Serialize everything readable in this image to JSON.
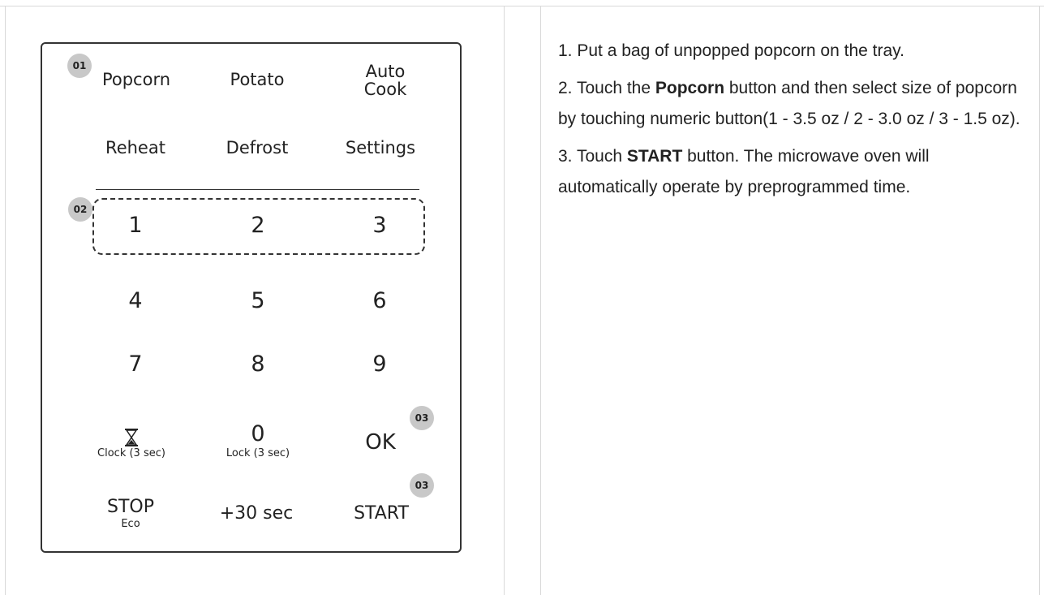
{
  "panel": {
    "buttons": {
      "popcorn": "Popcorn",
      "potato": "Potato",
      "auto_cook_line1": "Auto",
      "auto_cook_line2": "Cook",
      "reheat": "Reheat",
      "defrost": "Defrost",
      "settings": "Settings",
      "n1": "1",
      "n2": "2",
      "n3": "3",
      "n4": "4",
      "n5": "5",
      "n6": "6",
      "n7": "7",
      "n8": "8",
      "n9": "9",
      "clock_sub": "Clock (3 sec)",
      "n0": "0",
      "lock_sub": "Lock (3 sec)",
      "ok": "OK",
      "stop": "STOP",
      "eco_sub": "Eco",
      "plus30": "+30 sec",
      "start": "START"
    },
    "badges": {
      "b01": "01",
      "b02": "02",
      "b03_ok": "03",
      "b03_start": "03"
    }
  },
  "instructions": {
    "step1": "1. Put a bag of unpopped popcorn on the tray.",
    "step2_pre": "2. Touch the ",
    "step2_bold": "Popcorn",
    "step2_post": " button and then select size of popcorn by touching numeric button(1 - 3.5 oz / 2 - 3.0 oz / 3 - 1.5 oz).",
    "step3_pre": "3. Touch ",
    "step3_bold": "START",
    "step3_post": " button. The microwave oven will automatically operate by preprogrammed time."
  }
}
